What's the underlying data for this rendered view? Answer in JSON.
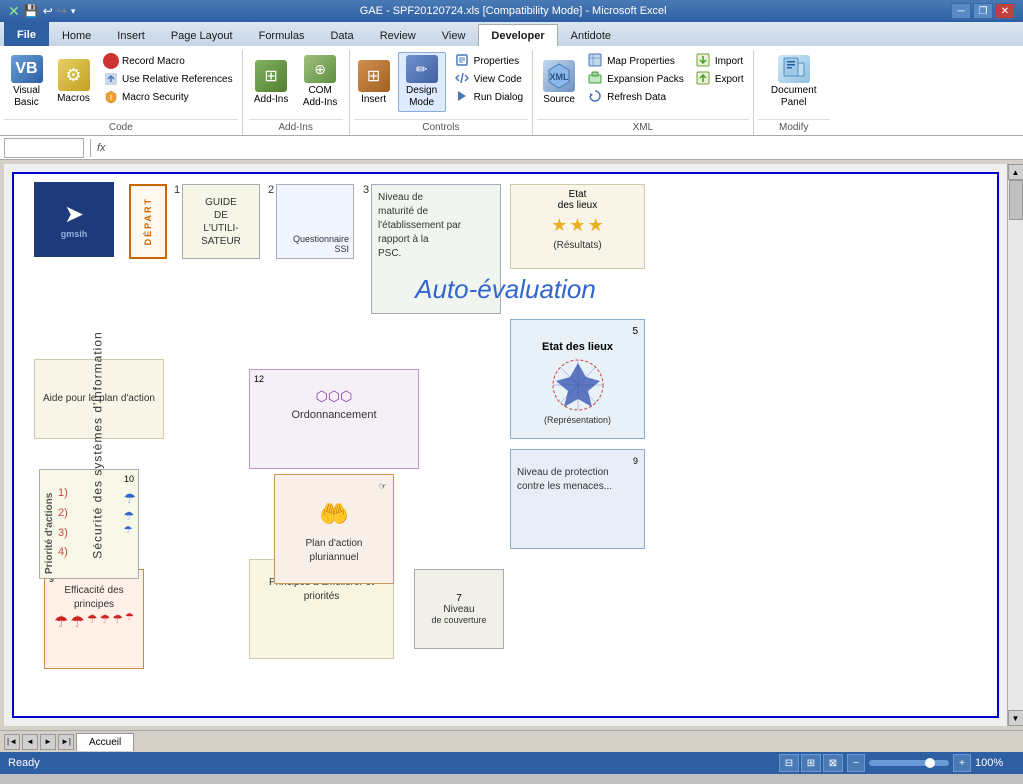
{
  "titleBar": {
    "title": "GAE - SPF20120724.xls [Compatibility Mode] - Microsoft Excel",
    "minBtn": "─",
    "restoreBtn": "❐",
    "closeBtn": "✕"
  },
  "quickAccess": {
    "saveIcon": "💾",
    "undoIcon": "↩",
    "redoIcon": "↪",
    "dropIcon": "▾"
  },
  "tabs": [
    {
      "label": "File",
      "id": "file"
    },
    {
      "label": "Home",
      "id": "home"
    },
    {
      "label": "Insert",
      "id": "insert"
    },
    {
      "label": "Page Layout",
      "id": "page-layout"
    },
    {
      "label": "Formulas",
      "id": "formulas"
    },
    {
      "label": "Data",
      "id": "data"
    },
    {
      "label": "Review",
      "id": "review"
    },
    {
      "label": "View",
      "id": "view"
    },
    {
      "label": "Developer",
      "id": "developer"
    },
    {
      "label": "Antidote",
      "id": "antidote"
    }
  ],
  "ribbon": {
    "groups": {
      "code": {
        "label": "Code",
        "visualBasic": "Visual\nBasic",
        "macros": "Macros",
        "recordMacro": "Record Macro",
        "useRelativeReferences": "Use Relative References",
        "macroSecurity": "Macro Security"
      },
      "addIns": {
        "label": "Add-Ins",
        "addIns": "Add-Ins",
        "comAddIns": "COM\nAdd-Ins"
      },
      "controls": {
        "label": "Controls",
        "insert": "Insert",
        "designMode": "Design\nMode",
        "properties": "Properties",
        "viewCode": "View Code",
        "runDialog": "Run Dialog"
      },
      "xml": {
        "label": "XML",
        "source": "Source",
        "mapProperties": "Map Properties",
        "import": "Import",
        "expansionPacks": "Expansion Packs",
        "export": "Export",
        "refreshData": "Refresh Data"
      },
      "modify": {
        "label": "Modify",
        "documentPanel": "Document\nPanel"
      }
    }
  },
  "formulaBar": {
    "nameBox": "",
    "fxLabel": "fx"
  },
  "diagram": {
    "title": "Auto-évaluation",
    "verticalText": "Sécurité des systèmes d'information",
    "sections": {
      "depart": "DÉPART",
      "guide": "GUIDE\nDE\nL'UTILI-\nSATEUR",
      "questionnaire": "Questionnaire SSI",
      "niveauMaturite": "Niveau de\nmaturité de\nl'établissement par\nrapport à la\nPSC.",
      "etatDesLieux1": "Etat\ndes lieux",
      "resultats": "(Résultats)",
      "etatDesLieux2": "Etat des lieux",
      "representation": "(Représentation)",
      "niveauProtection": "Niveau de\nprotection\ncontre les\nmenaces...",
      "couverture": "de couverture",
      "niveau": "Niveau",
      "ameliorer": "Principes à\naméliorer\net\npriorités",
      "efficacite": "Efficacité des\nprincipes",
      "priorite": "Priorité d'actions",
      "aide": "Aide pour\nle plan d'action",
      "ordonnancement": "Ordonnancement",
      "planAction": "Plan\nd'action\npluriannuel"
    }
  },
  "statusBar": {
    "ready": "Ready",
    "zoom": "100%",
    "zoomMinus": "─",
    "zoomPlus": "+"
  },
  "sheets": [
    {
      "label": "Accueil"
    }
  ]
}
